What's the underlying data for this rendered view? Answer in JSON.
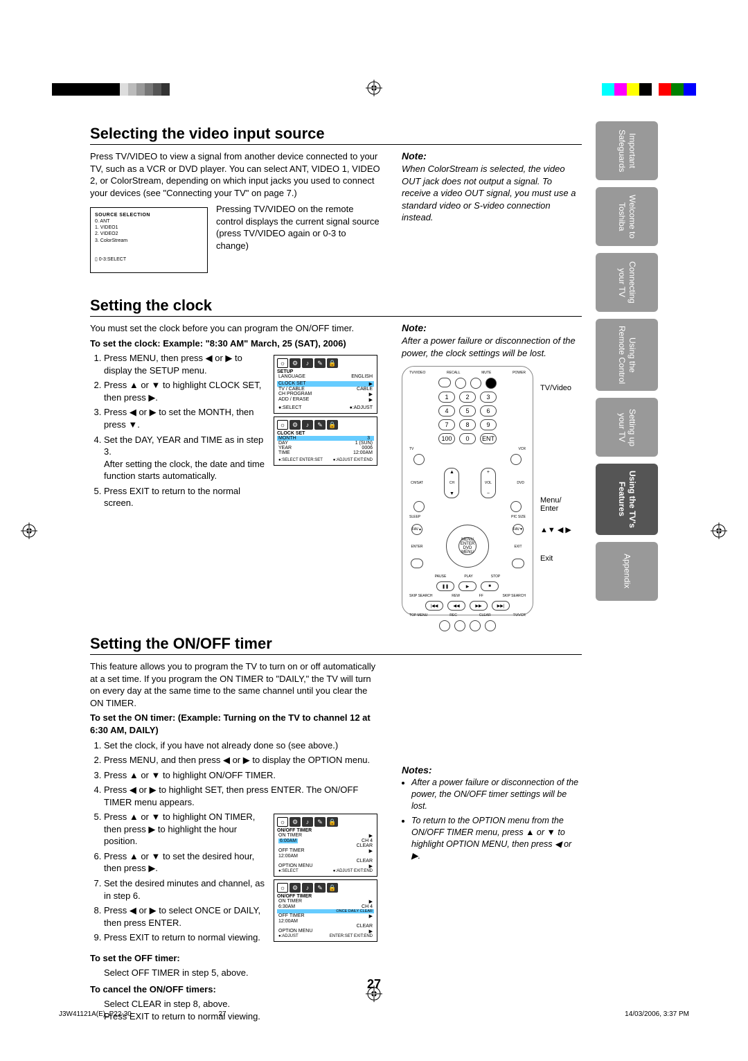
{
  "page_number": "27",
  "footer_left": "J3W41121A(E)_P22-30",
  "footer_left_pg": "27",
  "footer_right": "14/03/2006, 3:37 PM",
  "tabs": [
    {
      "l1": "Important",
      "l2": "Safeguards"
    },
    {
      "l1": "Welcome to",
      "l2": "Toshiba"
    },
    {
      "l1": "Connecting",
      "l2": "your TV"
    },
    {
      "l1": "Using the",
      "l2": "Remote Control"
    },
    {
      "l1": "Setting up",
      "l2": "your TV"
    },
    {
      "l1": "Using the TV's",
      "l2": "Features"
    },
    {
      "l1": "Appendix",
      "l2": ""
    }
  ],
  "s1": {
    "h": "Selecting the video input source",
    "p": "Press TV/VIDEO to view a signal from another device connected to your TV, such as a VCR or DVD player. You can select ANT, VIDEO 1, VIDEO 2, or ColorStream, depending on which input jacks you used to connect your devices (see \"Connecting your TV\" on page 7.)",
    "diag_title": "SOURCE SELECTION",
    "diag_items": [
      "0. ANT",
      "1. VIDEO1",
      "2. VIDEO2",
      "3. ColorStream"
    ],
    "diag_footer": "0-3:SELECT",
    "press_text": "Pressing TV/VIDEO on the remote control displays the current signal source (press TV/VIDEO again or 0-3 to change)",
    "note_h": "Note:",
    "note": "When ColorStream is selected, the video OUT jack does not output a signal. To receive a video OUT signal, you must use a standard video or S-video connection instead."
  },
  "s2": {
    "h": "Setting the clock",
    "intro": "You must set the clock before you can program the ON/OFF timer.",
    "tosethead": "To set the clock: Example: \"8:30 AM\" March, 25 (SAT), 2006)",
    "steps": [
      "Press MENU, then press ◀ or ▶ to display the SETUP menu.",
      "Press ▲ or ▼ to highlight CLOCK SET, then press ▶.",
      "Press ◀ or ▶ to set the MONTH, then press ▼.",
      "Set the DAY, YEAR and TIME as in step 3.\nAfter setting the clock, the date and time function starts automatically.",
      "Press EXIT to return to the normal screen."
    ],
    "osd1": {
      "title": "SETUP",
      "rows": [
        [
          "LANGUAGE",
          "ENGLISH"
        ],
        [
          "CLOCK SET",
          "▶"
        ],
        [
          "TV / CABLE",
          "CABLE"
        ],
        [
          "CH PROGRAM",
          "▶"
        ],
        [
          "ADD / ERASE",
          "▶"
        ]
      ],
      "foot": [
        "●:SELECT",
        "●:ADJUST"
      ],
      "hl": 1
    },
    "osd2": {
      "title": "CLOCK SET",
      "rows": [
        [
          "MONTH",
          "3"
        ],
        [
          "DAY",
          "1 (SUN)"
        ],
        [
          "YEAR",
          "0006"
        ],
        [
          "TIME",
          "12:00AM"
        ]
      ],
      "foot": [
        "●:SELECT  ENTER:SET",
        "●:ADJUST  EXIT:END"
      ],
      "hl": 0
    },
    "note_h": "Note:",
    "note": "After a power failure or disconnection of the power, the clock settings will be lost."
  },
  "s3": {
    "h": "Setting the ON/OFF timer",
    "intro": "This feature allows you to program the TV to turn on or off automatically at a set time. If you program the ON TIMER to \"DAILY,\" the TV will turn on every day at the same time to the same channel until you clear the ON TIMER.",
    "tosethead": "To set the ON timer: (Example: Turning on the TV to channel 12 at 6:30 AM, DAILY)",
    "steps": [
      "Set the clock, if you have not already done so (see above.)",
      "Press MENU, and then press ◀ or ▶ to display the OPTION menu.",
      "Press ▲ or ▼ to highlight ON/OFF TIMER.",
      "Press ◀ or ▶ to highlight SET, then press ENTER. The ON/OFF TIMER menu appears.",
      "Press ▲ or ▼ to highlight ON TIMER, then press ▶ to highlight the hour position.",
      "Press ▲ or ▼ to set the desired hour, then press ▶.",
      "Set the desired minutes and channel, as in step 6.",
      "Press ◀ or ▶ to select ONCE or DAILY, then press ENTER.",
      "Press EXIT to return to normal viewing."
    ],
    "offh": "To set the OFF timer:",
    "offp": "Select OFF TIMER in step 5, above.",
    "cancelh": "To cancel the ON/OFF timers:",
    "cancelp1": "Select CLEAR in step 8, above.",
    "cancelp2": "Press EXIT to return to normal viewing.",
    "osd1": {
      "title": "ON/OFF TIMER",
      "rows": [
        [
          "ON TIMER",
          "▶"
        ],
        [
          "6:00AM",
          "CH   4"
        ],
        [
          "",
          "CLEAR"
        ],
        [
          "OFF TIMER",
          "▶"
        ],
        [
          "12:00AM",
          ""
        ],
        [
          "",
          "CLEAR"
        ],
        [
          "OPTION MENU",
          "▶"
        ]
      ],
      "foot": [
        "●:SELECT",
        "●:ADJUST  EXIT:END"
      ],
      "hl": 1
    },
    "osd2": {
      "title": "ON/OFF TIMER",
      "rows": [
        [
          "ON TIMER",
          "▶"
        ],
        [
          "6:30AM",
          "CH   4"
        ],
        [
          "",
          "ONCE DAILY CLEAR"
        ],
        [
          "OFF TIMER",
          "▶"
        ],
        [
          "12:00AM",
          ""
        ],
        [
          "",
          "CLEAR"
        ],
        [
          "OPTION MENU",
          "▶"
        ]
      ],
      "foot": [
        "●:ADJUST",
        "ENTER:SET  EXIT:END"
      ],
      "hl": 2
    },
    "notes_h": "Notes:",
    "notes": [
      "After a power failure or disconnection of the power, the ON/OFF timer settings will be lost.",
      "To return to the OPTION menu from the ON/OFF TIMER menu, press ▲ or ▼ to highlight OPTION MENU, then press ◀ or ▶."
    ]
  },
  "remote_labels": {
    "tvvideo": "TV/Video",
    "menu": "Menu/\nEnter",
    "arrows": "▲▼ ◀ ▶",
    "exit": "Exit"
  },
  "remote_top": [
    "TV/VIDEO",
    "RECALL",
    "MUTE",
    "POWER"
  ],
  "remote_midlabels": [
    "TV",
    "VCR",
    "CH/SAT",
    "CH",
    "VOL",
    "DVD",
    "SLEEP",
    "PIC SIZE",
    "FAV",
    "ENTER",
    "EXIT",
    "PAUSE",
    "PLAY",
    "STOP",
    "SKIP SEARCH",
    "REW",
    "FF",
    "SKIP SEARCH",
    "TOP MENU",
    "REC",
    "CLEAR",
    "TV/VCR"
  ],
  "remote_nums": [
    "1",
    "2",
    "3",
    "4",
    "5",
    "6",
    "7",
    "8",
    "9",
    "100",
    "0",
    "ENT"
  ],
  "remote_center": "MENU ENTER DVD MENU"
}
